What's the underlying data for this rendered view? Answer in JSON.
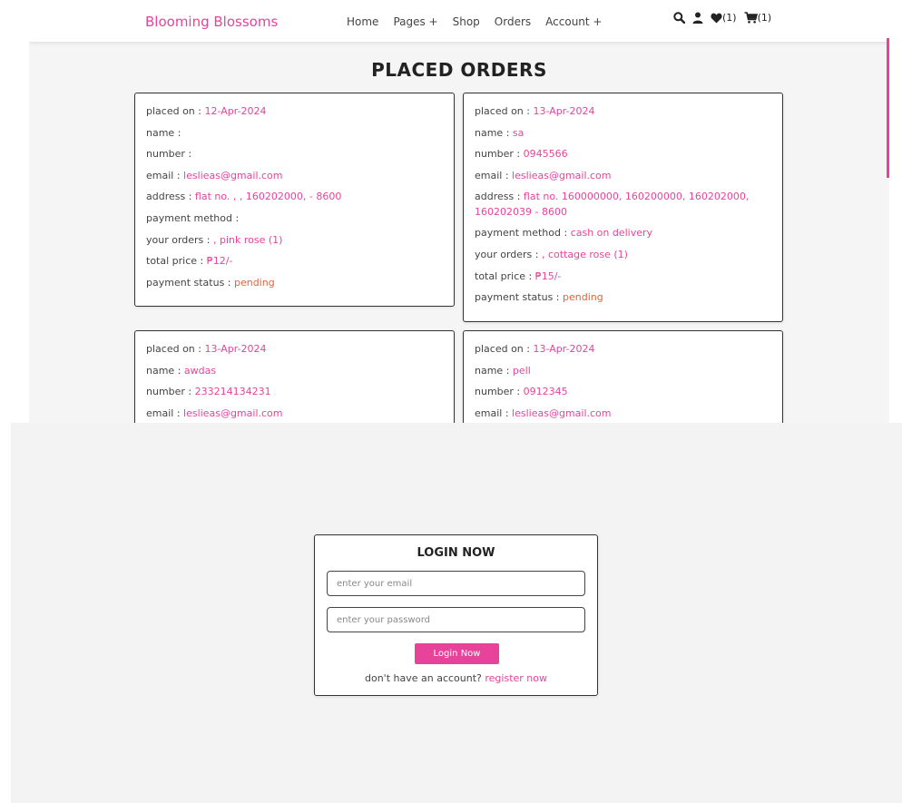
{
  "header": {
    "logo": "Blooming Blossoms",
    "nav": [
      "Home",
      "Pages +",
      "Shop",
      "Orders",
      "Account +"
    ],
    "wishlist_count": "(1)",
    "cart_count": "(1)"
  },
  "page_title": "PLACED ORDERS",
  "labels": {
    "placed_on": "placed on : ",
    "name": "name : ",
    "number": "number : ",
    "email": "email : ",
    "address": "address : ",
    "payment_method": "payment method : ",
    "your_orders": "your orders : ",
    "total_price": "total price : ",
    "payment_status": "payment status : "
  },
  "orders": [
    {
      "placed_on": "12-Apr-2024",
      "name": "",
      "number": "",
      "email": "leslieas@gmail.com",
      "address": "flat no. , , 160202000, - 8600",
      "payment_method": "",
      "your_orders": ", pink rose (1)",
      "total_price": "₱12/-",
      "payment_status": "pending"
    },
    {
      "placed_on": "13-Apr-2024",
      "name": "sa",
      "number": "0945566",
      "email": "leslieas@gmail.com",
      "address": "flat no. 160000000, 160200000, 160202000, 160202039 - 8600",
      "payment_method": "cash on delivery",
      "your_orders": ", cottage rose (1)",
      "total_price": "₱15/-",
      "payment_status": "pending"
    },
    {
      "placed_on": "13-Apr-2024",
      "name": "awdas",
      "number": "233214134231",
      "email": "leslieas@gmail.com"
    },
    {
      "placed_on": "13-Apr-2024",
      "name": "pell",
      "number": "0912345",
      "email": "leslieas@gmail.com"
    }
  ],
  "login": {
    "title": "LOGIN NOW",
    "email_placeholder": "enter your email",
    "password_placeholder": "enter your password",
    "button": "Login Now",
    "register_prompt": "don't have an account? ",
    "register_link": "register now"
  },
  "colors": {
    "accent": "#e8439a",
    "status": "#e8603c",
    "page_bg": "#f5f5f5"
  }
}
